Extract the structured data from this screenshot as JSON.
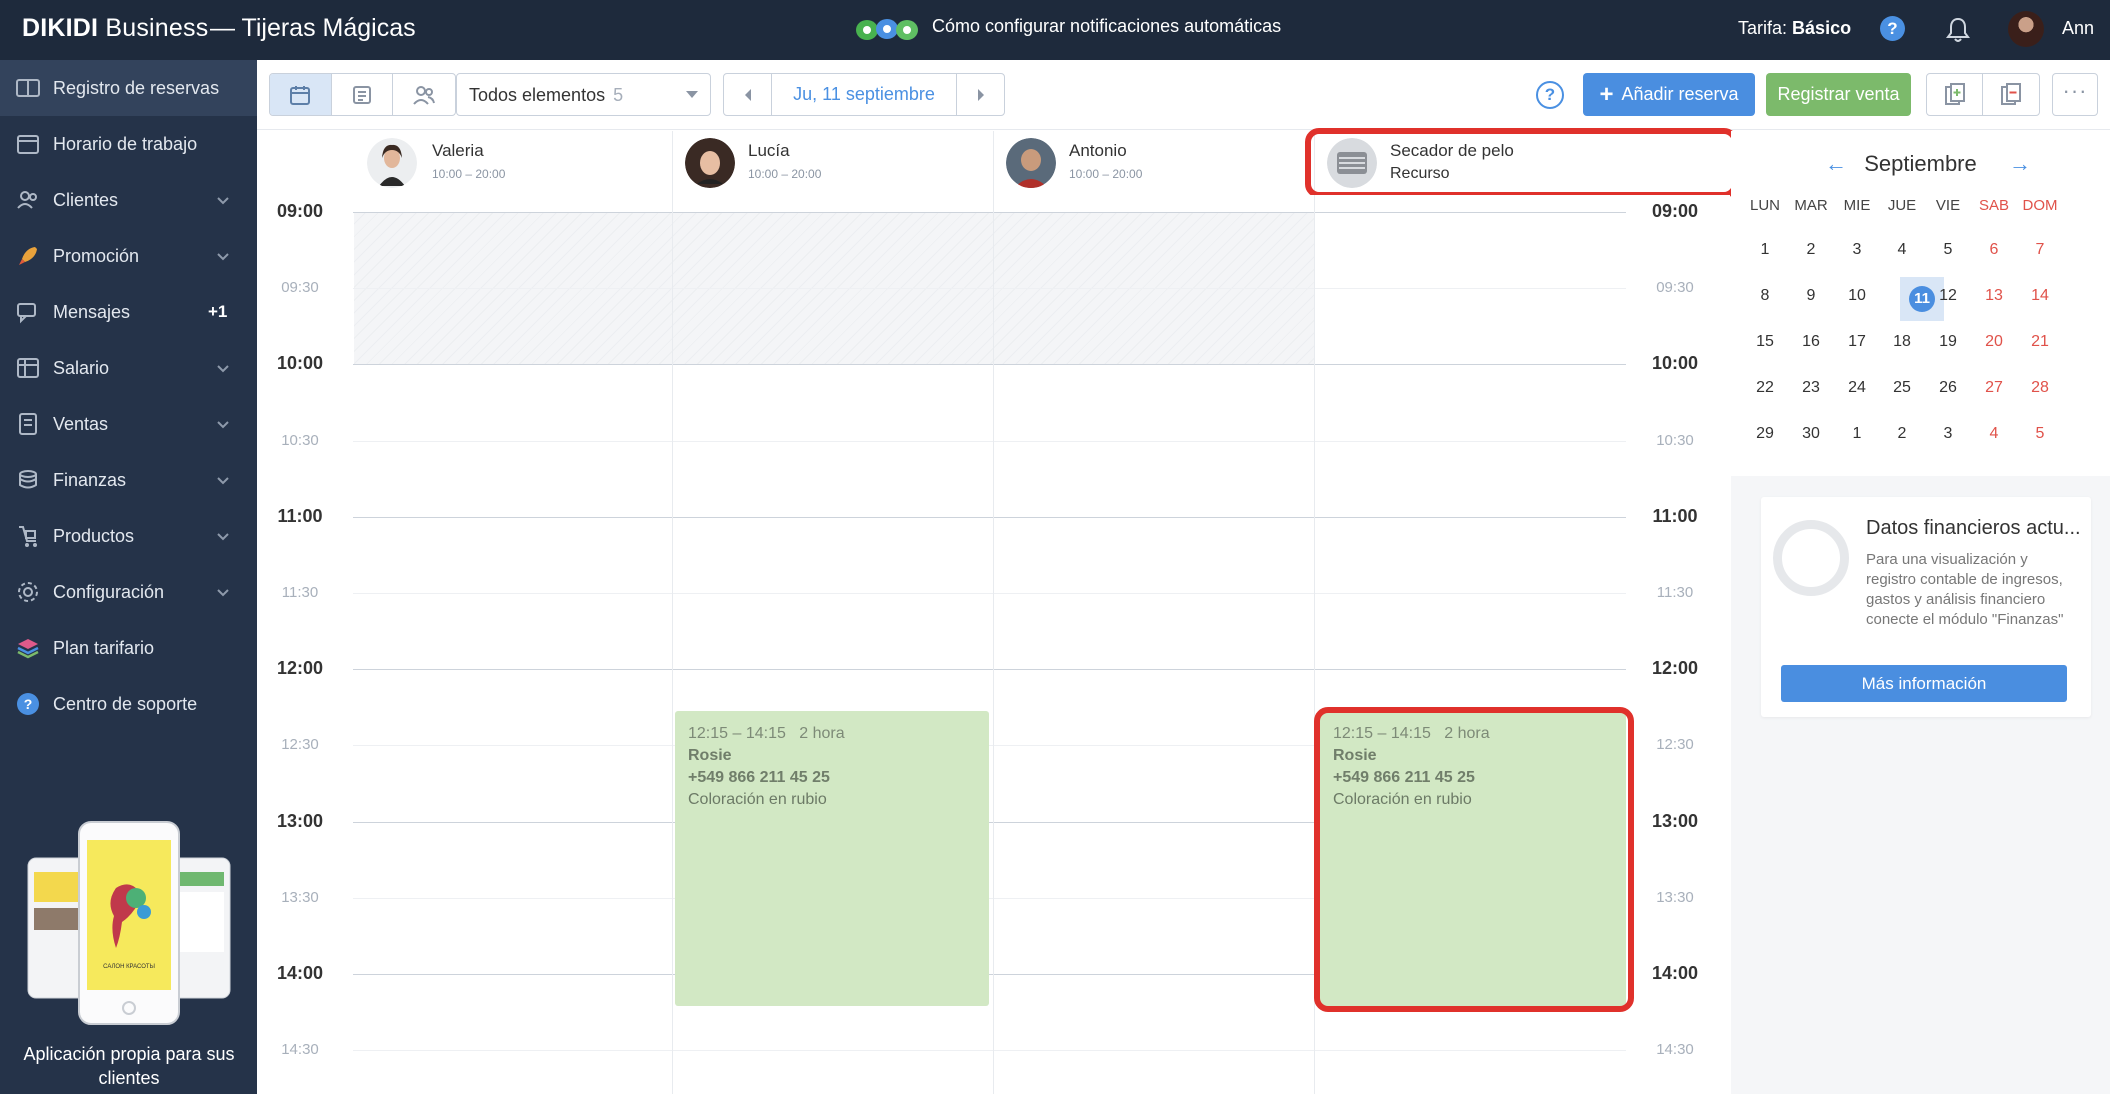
{
  "topbar": {
    "brand_strong": "DIKIDI",
    "brand_rest": " Business",
    "salon": "—  Tijeras Mágicas",
    "notification_link": "Cómo configurar notificaciones automáticas",
    "tarifa_label": "Tarifa:",
    "tarifa_value": "Básico",
    "help": "?",
    "user": "Ann"
  },
  "sidebar": {
    "items": [
      {
        "label": "Registro de reservas",
        "icon": "booking-log-icon",
        "active": true
      },
      {
        "label": "Horario de trabajo",
        "icon": "calendar-icon"
      },
      {
        "label": "Clientes",
        "icon": "clients-icon",
        "chevron": true
      },
      {
        "label": "Promoción",
        "icon": "rocket-icon",
        "chevron": true
      },
      {
        "label": "Mensajes",
        "icon": "messages-icon",
        "badge": "+1"
      },
      {
        "label": "Salario",
        "icon": "salary-icon",
        "chevron": true
      },
      {
        "label": "Ventas",
        "icon": "sales-icon",
        "chevron": true
      },
      {
        "label": "Finanzas",
        "icon": "finance-icon",
        "chevron": true
      },
      {
        "label": "Productos",
        "icon": "products-icon",
        "chevron": true
      },
      {
        "label": "Configuración",
        "icon": "gear-icon",
        "chevron": true
      },
      {
        "label": "Plan tarifario",
        "icon": "layers-icon"
      },
      {
        "label": "Centro de soporte",
        "icon": "support-icon"
      }
    ],
    "promo_text": "Aplicación propia para sus clientes"
  },
  "toolbar": {
    "elements_label": "Todos elementos",
    "elements_count": "5",
    "date": "Ju, 11 septiembre",
    "help": "?",
    "add_booking": "Añadir reserva",
    "add_plus": "+",
    "register_sale": "Registrar venta",
    "more": "···"
  },
  "staff": [
    {
      "name": "Valeria",
      "hours": "10:00 – 20:00"
    },
    {
      "name": "Lucía",
      "hours": "10:00 – 20:00"
    },
    {
      "name": "Antonio",
      "hours": "10:00 – 20:00"
    },
    {
      "name": "Secador de pelo",
      "hours": "Recurso"
    }
  ],
  "times": [
    {
      "label": "09:00",
      "type": "hour"
    },
    {
      "label": "09:30",
      "type": "half"
    },
    {
      "label": "10:00",
      "type": "hour"
    },
    {
      "label": "10:30",
      "type": "half"
    },
    {
      "label": "11:00",
      "type": "hour"
    },
    {
      "label": "11:30",
      "type": "half"
    },
    {
      "label": "12:00",
      "type": "hour"
    },
    {
      "label": "12:30",
      "type": "half"
    },
    {
      "label": "13:00",
      "type": "hour"
    },
    {
      "label": "13:30",
      "type": "half"
    },
    {
      "label": "14:00",
      "type": "hour"
    },
    {
      "label": "14:30",
      "type": "half"
    }
  ],
  "bookings": [
    {
      "time": "12:15 – 14:15",
      "duration": "2 hora",
      "client": "Rosie",
      "phone": "+549 866 211 45 25",
      "service": "Coloración en rubio",
      "column": "Lucía"
    },
    {
      "time": "12:15 – 14:15",
      "duration": "2 hora",
      "client": "Rosie",
      "phone": "+549 866 211 45 25",
      "service": "Coloración en rubio",
      "column": "Secador de pelo"
    }
  ],
  "calendar": {
    "month": "Septiembre",
    "prev": "←",
    "next": "→",
    "weekdays": [
      "LUN",
      "MAR",
      "MIE",
      "JUE",
      "VIE",
      "SAB",
      "DOM"
    ],
    "weeks": [
      [
        "1",
        "2",
        "3",
        "4",
        "5",
        "6",
        "7"
      ],
      [
        "8",
        "9",
        "10",
        "11",
        "12",
        "13",
        "14"
      ],
      [
        "15",
        "16",
        "17",
        "18",
        "19",
        "20",
        "21"
      ],
      [
        "22",
        "23",
        "24",
        "25",
        "26",
        "27",
        "28"
      ],
      [
        "29",
        "30",
        "1",
        "2",
        "3",
        "4",
        "5"
      ]
    ],
    "today": "11"
  },
  "finance_card": {
    "title": "Datos financieros actu...",
    "text": "Para una visualización y registro contable de ingresos, gastos y análisis financiero conecte el módulo \"Finanzas\"",
    "button": "Más información"
  },
  "colors": {
    "topbar": "#1e2a3c",
    "sidebar": "#253349",
    "accent": "#4a8ee0",
    "sale": "#7cba6b",
    "booking": "#d2e8c4",
    "highlight": "#e0312b",
    "weekend": "#e0524a"
  }
}
